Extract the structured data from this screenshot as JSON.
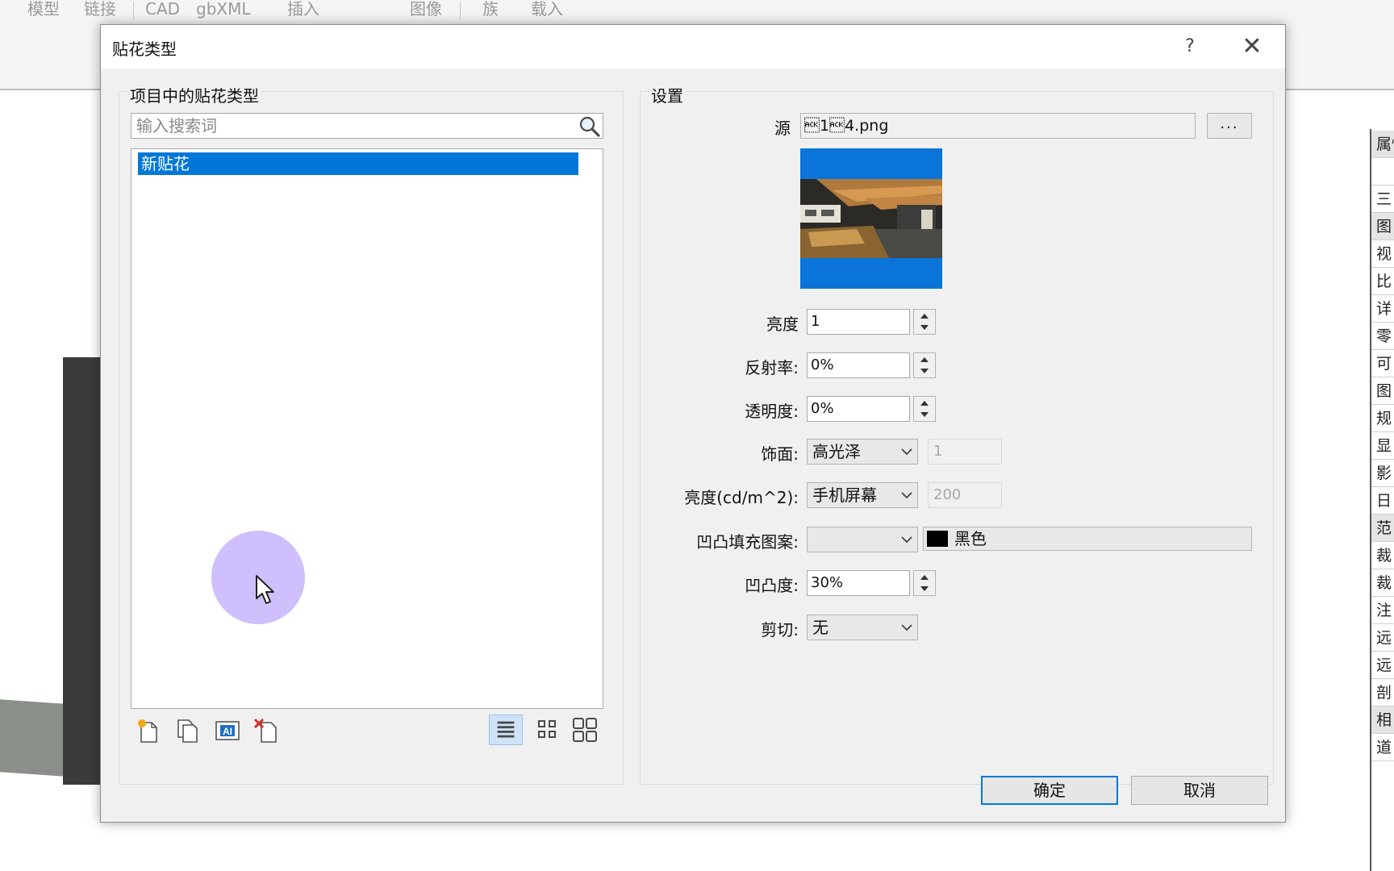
{
  "background": {
    "ribbon_tabs": [
      "模型",
      "链接",
      "CAD",
      "gbXML",
      "插入",
      "图像",
      "族",
      "载入"
    ],
    "properties_rows": [
      "属性",
      "",
      "三",
      "图",
      "视",
      "比",
      "详",
      "零",
      "可",
      "图",
      "规",
      "显",
      "影",
      "日",
      "范",
      "裁",
      "裁",
      "注",
      "远",
      "远",
      "剖",
      "相",
      "道"
    ]
  },
  "dialog": {
    "title": "贴花类型",
    "help_label": "?",
    "close_label": "✕",
    "left_group": {
      "label": "项目中的贴花类型",
      "search_placeholder": "输入搜索词",
      "items": [
        "新贴花"
      ]
    },
    "settings": {
      "label": "设置",
      "source_label": "源",
      "source_value": "\u00061\u00064.png",
      "browse_label": "...",
      "brightness_label": "亮度",
      "brightness_value": "1",
      "reflectance_label": "反射率:",
      "reflectance_value": "0%",
      "transparency_label": "透明度:",
      "transparency_value": "0%",
      "finish_label": "饰面:",
      "finish_value": "高光泽",
      "finish_extra": "1",
      "luminance_label": "亮度(cd/m^2):",
      "luminance_value": "手机屏幕",
      "luminance_extra": "200",
      "bump_pattern_label": "凹凸填充图案:",
      "bump_pattern_value": "",
      "bump_color_name": "黑色",
      "bump_amount_label": "凹凸度:",
      "bump_amount_value": "30%",
      "cutout_label": "剪切:",
      "cutout_value": "无"
    },
    "ok_label": "确定",
    "cancel_label": "取消"
  }
}
